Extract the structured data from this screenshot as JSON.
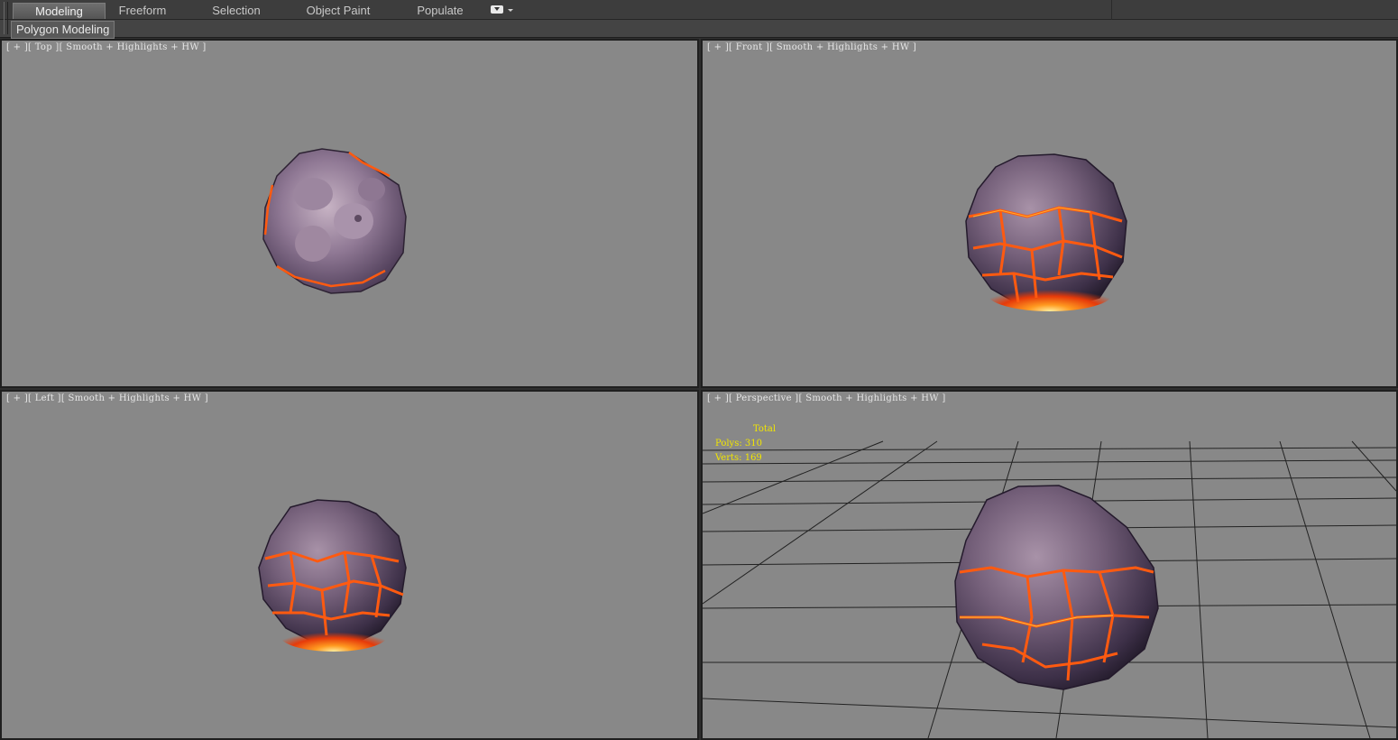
{
  "ribbon": {
    "tabs": [
      {
        "label": "Modeling",
        "active": true
      },
      {
        "label": "Freeform",
        "active": false
      },
      {
        "label": "Selection",
        "active": false
      },
      {
        "label": "Object Paint",
        "active": false
      },
      {
        "label": "Populate",
        "active": false
      }
    ],
    "panel_label": "Polygon Modeling"
  },
  "viewports": {
    "top": {
      "label": "[ + ][ Top ][ Smooth + Highlights + HW ]"
    },
    "front": {
      "label": "[ + ][ Front ][ Smooth + Highlights + HW ]"
    },
    "left": {
      "label": "[ + ][ Left ][ Smooth + Highlights + HW ]"
    },
    "perspective": {
      "label": "[ + ][ Perspective ][ Smooth + Highlights + HW ]"
    }
  },
  "stats": {
    "total": "Total",
    "polys": "Polys: 310",
    "verts": "Verts: 169"
  },
  "colors": {
    "viewport_bg": "#888888",
    "stats_text": "#f2e600",
    "lava": "#ff5a10",
    "rock": "#6b5870"
  }
}
